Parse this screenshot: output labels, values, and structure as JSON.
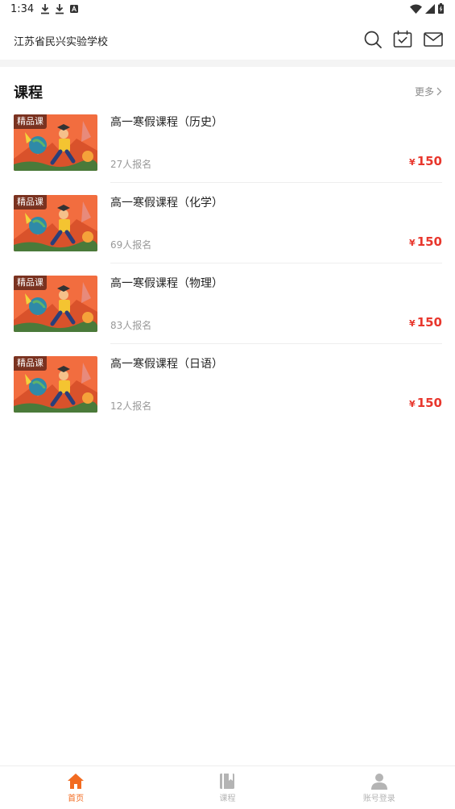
{
  "status_bar": {
    "time": "1:34"
  },
  "header": {
    "school_name": "江苏省民兴实验学校"
  },
  "section": {
    "title": "课程",
    "more_label": "更多"
  },
  "courses": [
    {
      "badge": "精品课",
      "title": "高一寒假课程（历史）",
      "enrolled": "27人报名",
      "currency": "¥",
      "price": "150"
    },
    {
      "badge": "精品课",
      "title": "高一寒假课程（化学）",
      "enrolled": "69人报名",
      "currency": "¥",
      "price": "150"
    },
    {
      "badge": "精品课",
      "title": "高一寒假课程（物理）",
      "enrolled": "83人报名",
      "currency": "¥",
      "price": "150"
    },
    {
      "badge": "精品课",
      "title": "高一寒假课程（日语）",
      "enrolled": "12人报名",
      "currency": "¥",
      "price": "150"
    }
  ],
  "bottom_nav": [
    {
      "label": "首页",
      "icon": "home-icon",
      "active": true
    },
    {
      "label": "课程",
      "icon": "book-icon",
      "active": false
    },
    {
      "label": "账号登录",
      "icon": "user-icon",
      "active": false
    }
  ],
  "colors": {
    "accent": "#f26b21",
    "price": "#e8372d",
    "badge_bg": "#7a3220"
  }
}
